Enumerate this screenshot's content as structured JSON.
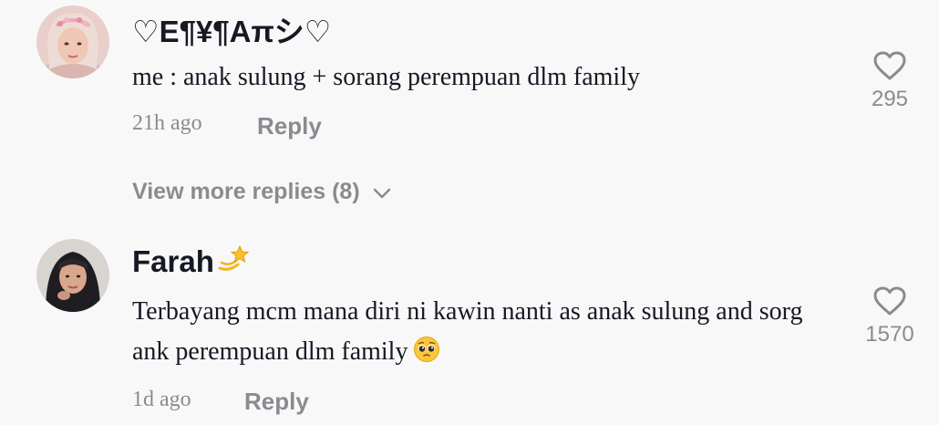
{
  "comments": [
    {
      "username": "♡E¶¥¶Aπシ♡",
      "text": "me : anak sulung + sorang perempuan dlm family",
      "time": "21h ago",
      "reply_label": "Reply",
      "likes": "295",
      "view_more_label": "View more replies (8)"
    },
    {
      "username": "Farah",
      "username_emoji": "dizzy-emoji",
      "text": "Terbayang mcm mana diri ni kawin nanti as anak sulung and sorg ank perempuan dlm family",
      "text_emoji": "pleading-face-emoji",
      "time": "1d ago",
      "reply_label": "Reply",
      "likes": "1570"
    }
  ],
  "icons": {
    "like": "heart-outline-icon",
    "expand": "chevron-down-icon"
  },
  "colors": {
    "background": "#f8f8f8",
    "primary_text": "#161823",
    "secondary_text": "#8a8b91"
  }
}
